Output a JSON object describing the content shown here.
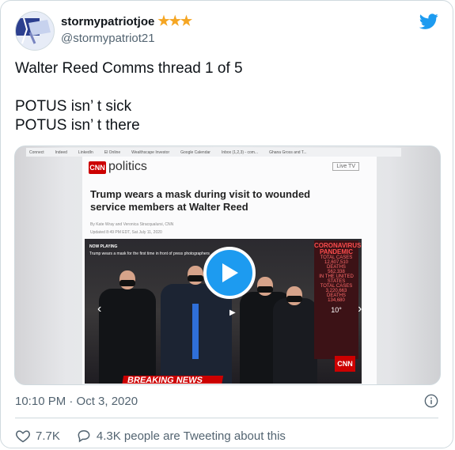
{
  "user": {
    "display_name": "stormypatriotjoe",
    "badge": "★★★",
    "handle": "@stormypatriot21"
  },
  "tweet": {
    "text": "Walter Reed Comms thread 1 of 5\n\nPOTUS isn’ t sick\nPOTUS isn’ t there"
  },
  "media": {
    "bookmarks": [
      "Connect",
      "Indeed",
      "LinkedIn",
      "El Online",
      "Wealthscape Investor",
      "Google Calendar",
      "Inbox (1,2,3) - com...",
      "Ghana Gross and T..."
    ],
    "logo": "CNN",
    "section": "politics",
    "live_tv": "Live TV",
    "headline": "Trump wears a mask during visit to wounded service members at Walter Reed",
    "byline": "By Kate Wray and Veronica Stracqualursi, CNN",
    "updated": "Updated 8:49 PM EDT, Sat July 11, 2020",
    "now_playing": "NOW PLAYING",
    "video_caption": "Trump wears a mask for the first time in front of press photographers",
    "breaking": "BREAKING NEWS",
    "corona_title": "CORONAVIRUS PANDEMIC",
    "corona_lines": [
      "TOTAL CASES",
      "12,607,510",
      "DEATHS",
      "562,338",
      "IN THE UNITED STATES",
      "TOTAL CASES",
      "3,220,663",
      "DEATHS",
      "134,680"
    ],
    "corona_temp": "10°"
  },
  "timestamp": "10:10 PM · Oct 3, 2020",
  "stats": {
    "likes": "7.7K",
    "replies_text": "4.3K people are Tweeting about this"
  },
  "colors": {
    "accent": "#1d9bf0",
    "muted": "#536471",
    "star": "#f5a623",
    "cnn_red": "#cc0000"
  }
}
